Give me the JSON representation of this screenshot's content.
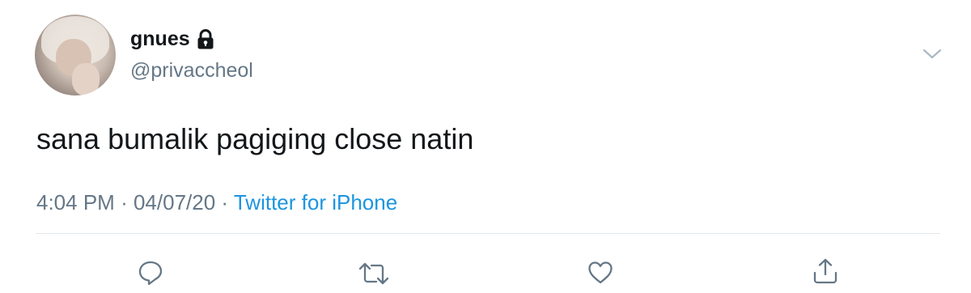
{
  "tweet": {
    "display_name": "gnues",
    "handle": "@privaccheol",
    "text": "sana bumalik pagiging close natin",
    "time": "4:04 PM",
    "separator": "·",
    "date": "04/07/20",
    "source": "Twitter for iPhone",
    "protected": true
  },
  "icons": {
    "lock": "lock-icon",
    "menu": "chevron-down-icon",
    "reply": "reply-icon",
    "retweet": "retweet-icon",
    "like": "like-icon",
    "share": "share-icon"
  },
  "colors": {
    "text_primary": "#14171a",
    "text_secondary": "#657786",
    "link": "#1b95e0",
    "divider": "#e1e8ed",
    "icon": "#657786"
  }
}
